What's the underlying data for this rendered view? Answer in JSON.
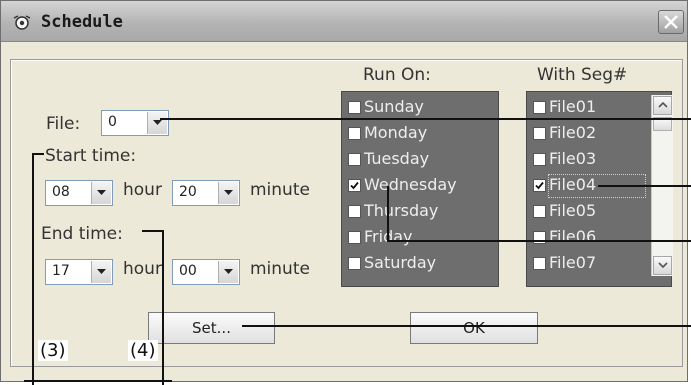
{
  "window": {
    "title": "Schedule",
    "close_glyph": "×"
  },
  "file": {
    "label": "File:",
    "value": "0"
  },
  "start": {
    "label": "Start time:",
    "hour": "08",
    "hour_unit": "hour",
    "minute": "20",
    "minute_unit": "minute"
  },
  "end": {
    "label": "End time:",
    "hour": "17",
    "hour_unit": "hour",
    "minute": "00",
    "minute_unit": "minute"
  },
  "run_on": {
    "header": "Run On:",
    "days": [
      {
        "label": "Sunday",
        "checked": false
      },
      {
        "label": "Monday",
        "checked": false
      },
      {
        "label": "Tuesday",
        "checked": false
      },
      {
        "label": "Wednesday",
        "checked": true
      },
      {
        "label": "Thursday",
        "checked": false
      },
      {
        "label": "Friday",
        "checked": false
      },
      {
        "label": "Saturday",
        "checked": false
      }
    ]
  },
  "with_seg": {
    "header": "With Seg#",
    "files": [
      {
        "label": "File01",
        "checked": false
      },
      {
        "label": "File02",
        "checked": false
      },
      {
        "label": "File03",
        "checked": false
      },
      {
        "label": "File04",
        "checked": true
      },
      {
        "label": "File05",
        "checked": false
      },
      {
        "label": "File06",
        "checked": false
      },
      {
        "label": "File07",
        "checked": false
      }
    ]
  },
  "buttons": {
    "set": "Set...",
    "ok": "OK"
  },
  "callouts": {
    "c3": "(3)",
    "c4": "(4)"
  }
}
